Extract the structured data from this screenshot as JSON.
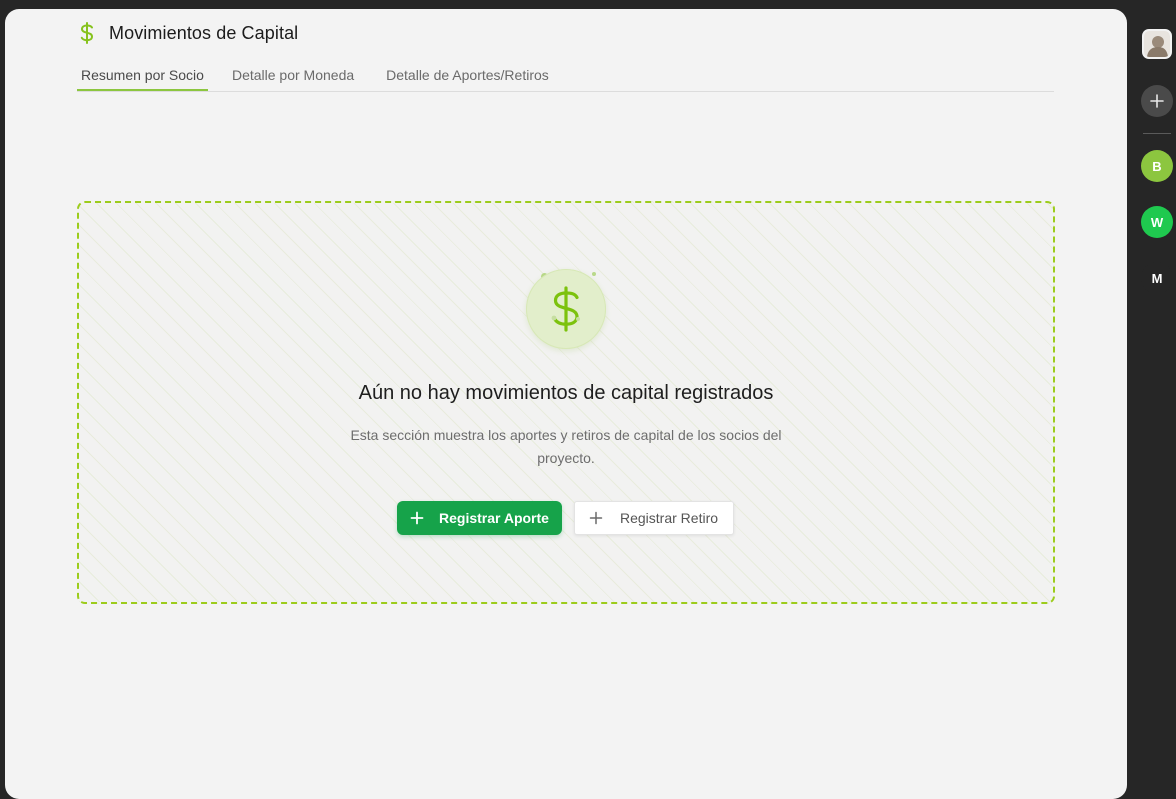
{
  "header": {
    "title": "Movimientos de Capital",
    "icon": "dollar-icon"
  },
  "tabs": [
    {
      "label": "Resumen por Socio",
      "active": true
    },
    {
      "label": "Detalle por Moneda",
      "active": false
    },
    {
      "label": "Detalle de Aportes/Retiros",
      "active": false
    }
  ],
  "empty_state": {
    "icon": "dollar-icon",
    "title": "Aún no hay movimientos de capital registrados",
    "description": "Esta sección muestra los aportes y retiros de capital de los socios del proyecto.",
    "primary_button": "Registrar Aporte",
    "secondary_button": "Registrar Retiro"
  },
  "rail": {
    "avatar": "user-avatar",
    "add_icon": "plus-icon",
    "workspaces": [
      {
        "initial": "B",
        "color": "#8cc63f"
      },
      {
        "initial": "W",
        "color": "#1fc94f"
      },
      {
        "initial": "M",
        "color": "#262626"
      }
    ]
  },
  "colors": {
    "accent": "#8cc63f",
    "primary_button": "#16a34a",
    "dashed_border": "#9ccc1c",
    "background": "#f3f3f3",
    "frame": "#262626"
  }
}
